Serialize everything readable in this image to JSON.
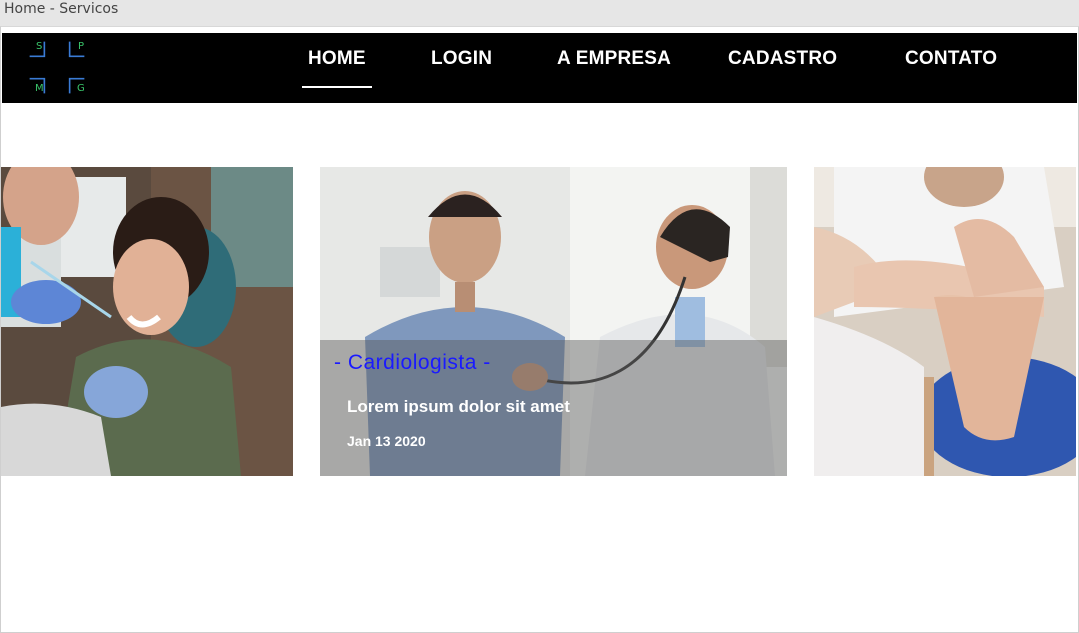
{
  "window": {
    "title": "Home - Servicos"
  },
  "logo": {
    "letters": [
      "S",
      "P",
      "M",
      "G"
    ]
  },
  "nav": {
    "items": [
      {
        "label": "HOME",
        "active": true
      },
      {
        "label": "LOGIN"
      },
      {
        "label": "A EMPRESA"
      },
      {
        "label": "CADASTRO"
      },
      {
        "label": "CONTATO"
      }
    ]
  },
  "carousel": {
    "cards": [
      {
        "image": "dentist-with-patient-photo"
      },
      {
        "image": "doctor-stethoscope-photo",
        "title": "- Cardiologista -",
        "subtitle": "Lorem ipsum dolor sit amet",
        "date": "Jan 13 2020"
      },
      {
        "image": "physiotherapy-foot-photo"
      }
    ]
  },
  "colors": {
    "navbar": "#000000",
    "accent_title": "#1a1aff",
    "logo_lines": "#3a7bd5",
    "logo_letters": "#39c46a"
  }
}
